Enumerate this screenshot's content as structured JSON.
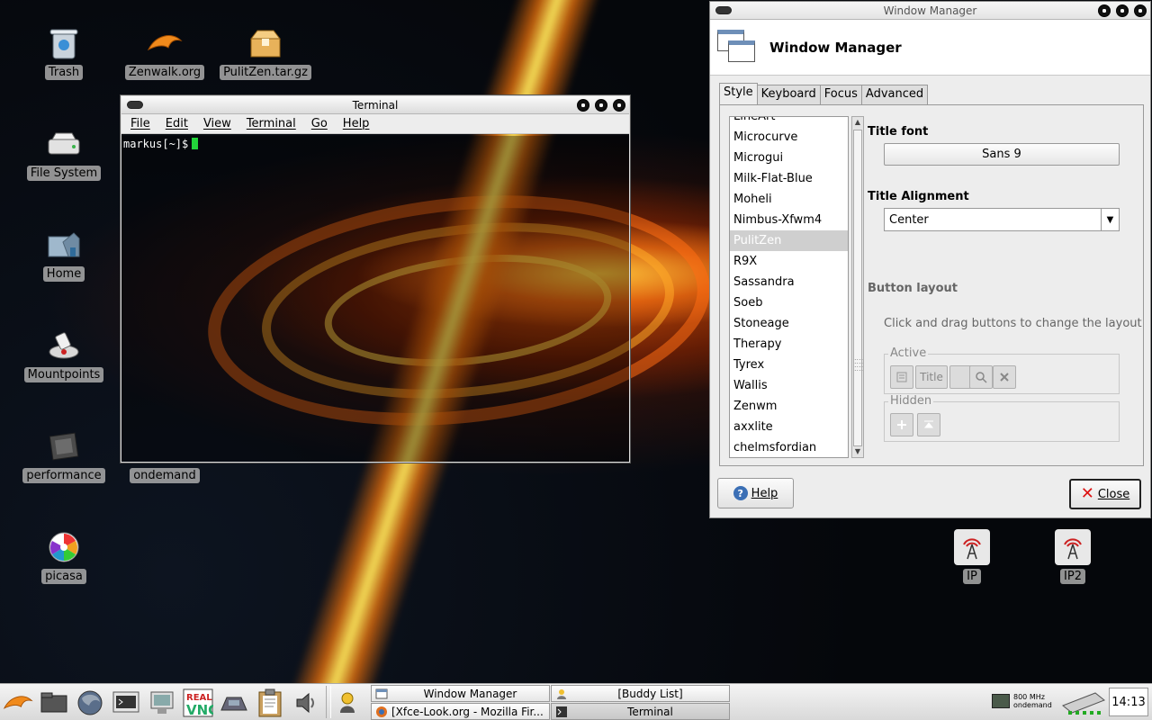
{
  "desktop": {
    "icons": [
      {
        "label": "Trash",
        "icon": "trash-icon"
      },
      {
        "label": "Zenwalk.org",
        "icon": "dolphin-icon"
      },
      {
        "label": "PulitZen.tar.gz",
        "icon": "archive-icon"
      },
      {
        "label": "File System",
        "icon": "drive-icon"
      },
      {
        "label": "Home",
        "icon": "home-folder-icon"
      },
      {
        "label": "Mountpoints",
        "icon": "mount-icon"
      },
      {
        "label": "performance",
        "icon": "cpu-chip-icon"
      },
      {
        "label": "ondemand",
        "icon": ""
      },
      {
        "label": "picasa",
        "icon": "picasa-icon"
      },
      {
        "label": "IP",
        "icon": "antenna-icon"
      },
      {
        "label": "IP2",
        "icon": "antenna-icon"
      }
    ]
  },
  "terminal": {
    "title": "Terminal",
    "menu": [
      "File",
      "Edit",
      "View",
      "Terminal",
      "Go",
      "Help"
    ],
    "prompt": "markus[~]$"
  },
  "window_manager": {
    "window_title": "Window Manager",
    "header_title": "Window Manager",
    "tabs": [
      "Style",
      "Keyboard",
      "Focus",
      "Advanced"
    ],
    "active_tab": "Style",
    "themes_partial_top": "LineArt",
    "themes": [
      "Microcurve",
      "Microgui",
      "Milk-Flat-Blue",
      "Moheli",
      "Nimbus-Xfwm4",
      "PulitZen",
      "R9X",
      "Sassandra",
      "Soeb",
      "Stoneage",
      "Therapy",
      "Tyrex",
      "Wallis",
      "Zenwm",
      "axxlite",
      "chelmsfordian"
    ],
    "selected_theme": "PulitZen",
    "title_font_label": "Title font",
    "title_font_value": "Sans 9",
    "title_alignment_label": "Title Alignment",
    "title_alignment_value": "Center",
    "button_layout_label": "Button layout",
    "button_layout_hint": "Click and drag buttons to change the layout",
    "active_label": "Active",
    "hidden_label": "Hidden",
    "active_title_button": "Title",
    "help_label": "Help",
    "close_label": "Close"
  },
  "panel": {
    "tasks": [
      {
        "label": "Window Manager",
        "icon": "window-icon"
      },
      {
        "label": "[Buddy List]",
        "icon": "buddy-icon"
      },
      {
        "label": "[Xfce-Look.org - Mozilla Fir...",
        "icon": "firefox-icon"
      },
      {
        "label": "Terminal",
        "icon": "terminal-icon"
      }
    ],
    "cpu_freq": "800 MHz",
    "cpu_governor": "ondemand",
    "clock": "14:13"
  }
}
